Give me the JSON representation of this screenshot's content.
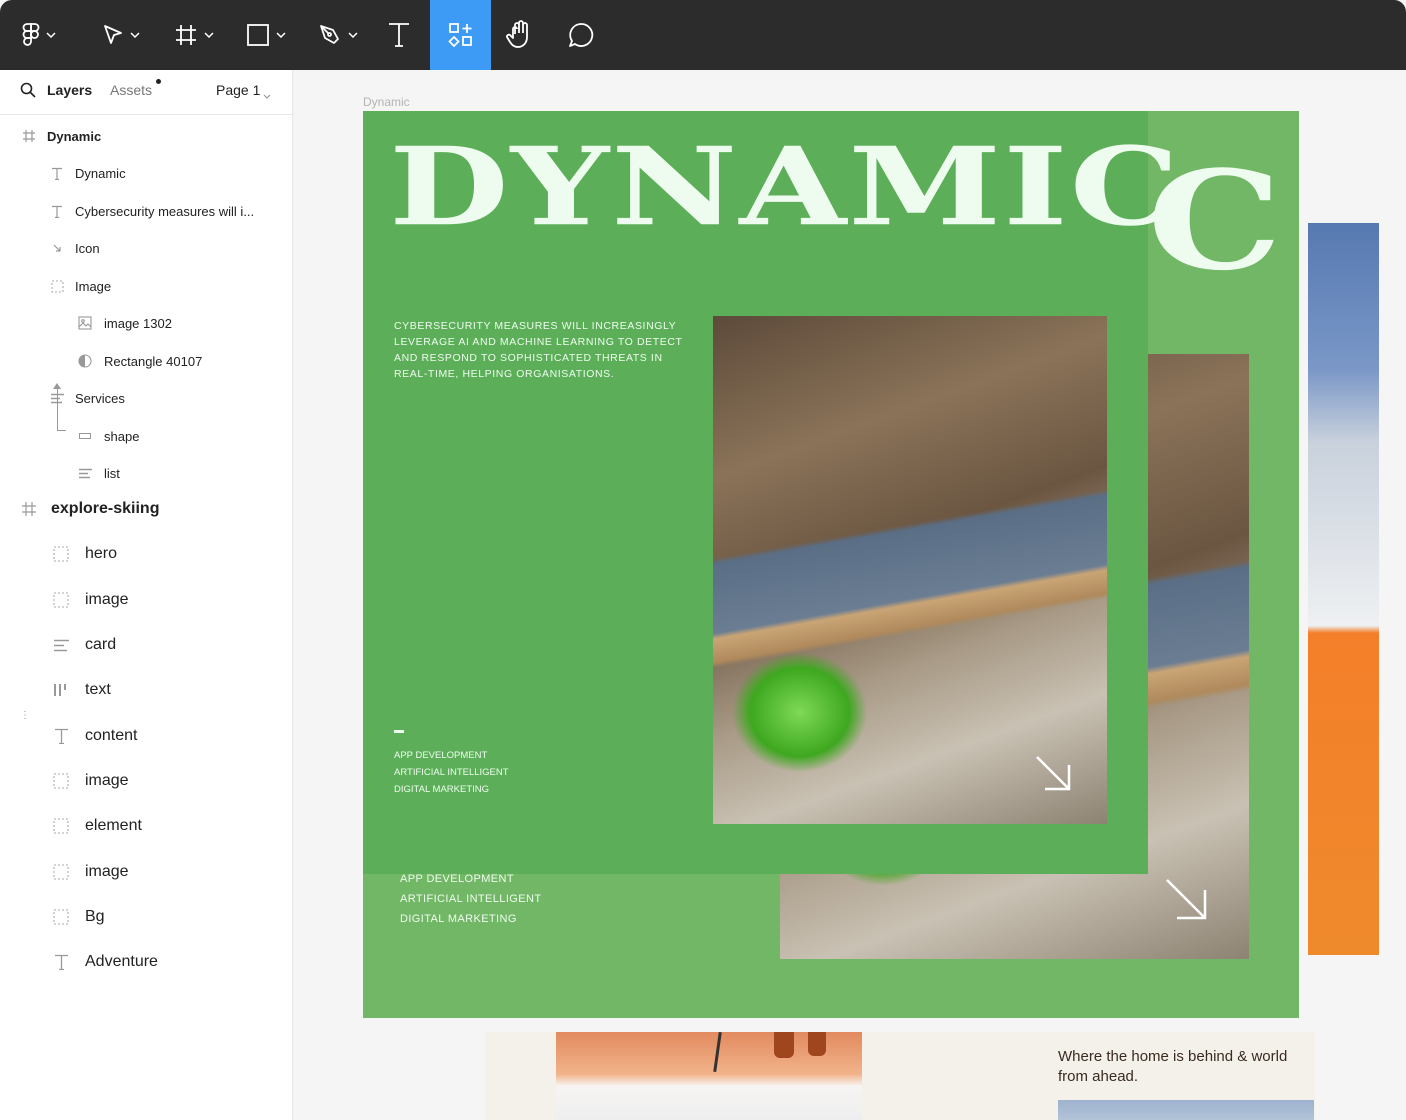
{
  "toolbar": {
    "tools": [
      {
        "name": "figma-menu",
        "icon": "figma-logo-icon",
        "has_dropdown": true
      },
      {
        "name": "move-tool",
        "icon": "move-arrow-icon",
        "has_dropdown": true
      },
      {
        "name": "frame-tool",
        "icon": "frame-grid-icon",
        "has_dropdown": true
      },
      {
        "name": "shape-tool",
        "icon": "rectangle-icon",
        "has_dropdown": true
      },
      {
        "name": "pen-tool",
        "icon": "pen-nib-icon",
        "has_dropdown": true
      },
      {
        "name": "text-tool",
        "icon": "text-icon",
        "has_dropdown": false
      },
      {
        "name": "resources-tool",
        "icon": "components-icon",
        "active": true
      },
      {
        "name": "hand-tool",
        "icon": "hand-icon"
      },
      {
        "name": "comment-tool",
        "icon": "comment-icon"
      }
    ],
    "accent_color": "#3d9bf5"
  },
  "sidebar": {
    "tabs": {
      "layers": "Layers",
      "assets": "Assets"
    },
    "page": "Page 1",
    "layers": [
      {
        "label": "Dynamic",
        "icon": "frame-hash-icon",
        "bold": true
      },
      {
        "label": "Dynamic",
        "icon": "text-t-icon"
      },
      {
        "label": "Cybersecurity measures will i...",
        "icon": "text-t-icon"
      },
      {
        "label": "Icon",
        "icon": "arrow-icon"
      },
      {
        "label": "Image",
        "icon": "dashed-frame-icon"
      },
      {
        "label": "image 1302",
        "icon": "image-icon"
      },
      {
        "label": "Rectangle 40107",
        "icon": "half-circle-icon"
      },
      {
        "label": "Services",
        "icon": "list-lines-icon"
      },
      {
        "label": "shape",
        "icon": "rectangle-outline-icon"
      },
      {
        "label": "list",
        "icon": "list-lines-icon"
      },
      {
        "label": "explore-skiing",
        "icon": "frame-hash-icon",
        "bold": true
      },
      {
        "label": "hero",
        "icon": "dashed-frame-icon"
      },
      {
        "label": "image",
        "icon": "dashed-frame-icon"
      },
      {
        "label": "card",
        "icon": "list-lines-icon"
      },
      {
        "label": "text",
        "icon": "columns-icon"
      },
      {
        "label": "content",
        "icon": "text-t-icon"
      },
      {
        "label": "image",
        "icon": "dashed-frame-icon"
      },
      {
        "label": "element",
        "icon": "dashed-frame-icon"
      },
      {
        "label": "image",
        "icon": "dashed-frame-icon"
      },
      {
        "label": "Bg",
        "icon": "dashed-frame-icon"
      },
      {
        "label": "Adventure",
        "icon": "text-t-icon"
      }
    ]
  },
  "canvas": {
    "frame_label": "Dynamic",
    "poster": {
      "title": "DYNAMIC",
      "back_title_letter": "C",
      "description": "CYBERSECURITY MEASURES WILL INCREASINGLY LEVERAGE AI AND MACHINE LEARNING TO DETECT AND RESPOND TO SOPHISTICATED THREATS IN REAL-TIME, HELPING ORGANISATIONS.",
      "services": [
        "APP DEVELOPMENT",
        "ARTIFICIAL INTELLIGENT",
        "DIGITAL MARKETING"
      ],
      "front_color": "#5caf58",
      "back_color": "#72b765"
    },
    "bottom_card": {
      "tagline": "Where the home is behind & world from ahead."
    }
  }
}
